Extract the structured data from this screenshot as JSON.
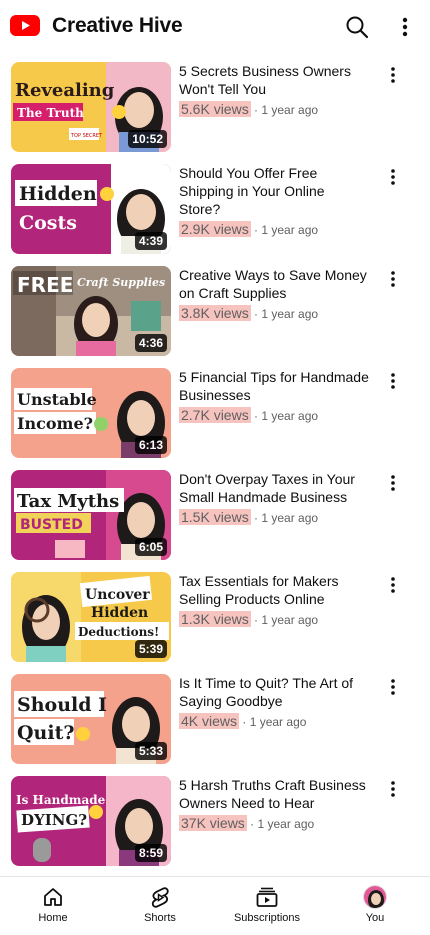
{
  "header": {
    "channel_name": "Creative Hive"
  },
  "videos": [
    {
      "title": "5 Secrets Business Owners Won't Tell You",
      "views": "5.6K views",
      "age": "1 year ago",
      "duration": "10:52",
      "thumb_text": [
        "Revealing",
        "The Truth",
        "TOP SECRET"
      ]
    },
    {
      "title": "Should You Offer Free Shipping in Your Online Store?",
      "views": "2.9K views",
      "age": "1 year ago",
      "duration": "4:39",
      "thumb_text": [
        "Hidden",
        "Costs"
      ]
    },
    {
      "title": "Creative Ways to Save Money on Craft Supplies",
      "views": "3.8K views",
      "age": "1 year ago",
      "duration": "4:36",
      "thumb_text": [
        "FREE",
        "Craft Supplies"
      ]
    },
    {
      "title": "5 Financial Tips for Handmade Businesses",
      "views": "2.7K views",
      "age": "1 year ago",
      "duration": "6:13",
      "thumb_text": [
        "Unstable",
        "Income?"
      ]
    },
    {
      "title": "Don't Overpay Taxes in Your Small Handmade Business",
      "views": "1.5K views",
      "age": "1 year ago",
      "duration": "6:05",
      "thumb_text": [
        "Tax Myths",
        "BUSTED"
      ]
    },
    {
      "title": "Tax Essentials for Makers Selling Products Online",
      "views": "1.3K views",
      "age": "1 year ago",
      "duration": "5:39",
      "thumb_text": [
        "Uncover",
        "Hidden",
        "Deductions!"
      ]
    },
    {
      "title": "Is It Time to Quit? The Art of Saying Goodbye",
      "views": "4K views",
      "age": "1 year ago",
      "duration": "5:33",
      "thumb_text": [
        "Should I",
        "Quit?"
      ]
    },
    {
      "title": "5 Harsh Truths Craft Business Owners Need to Hear",
      "views": "37K views",
      "age": "1 year ago",
      "duration": "8:59",
      "thumb_text": [
        "Is Handmade",
        "DYING?"
      ]
    }
  ],
  "nav": {
    "home": "Home",
    "shorts": "Shorts",
    "subscriptions": "Subscriptions",
    "you": "You"
  },
  "icons": {
    "logo": "youtube-logo-icon",
    "search": "search-icon",
    "more": "more-vert-icon",
    "home": "home-icon",
    "shorts": "shorts-icon",
    "subscriptions": "subscriptions-icon"
  },
  "colors": {
    "brand_red": "#ff0000",
    "views_highlight": "#f7c3bf",
    "secondary_text": "#606060"
  }
}
